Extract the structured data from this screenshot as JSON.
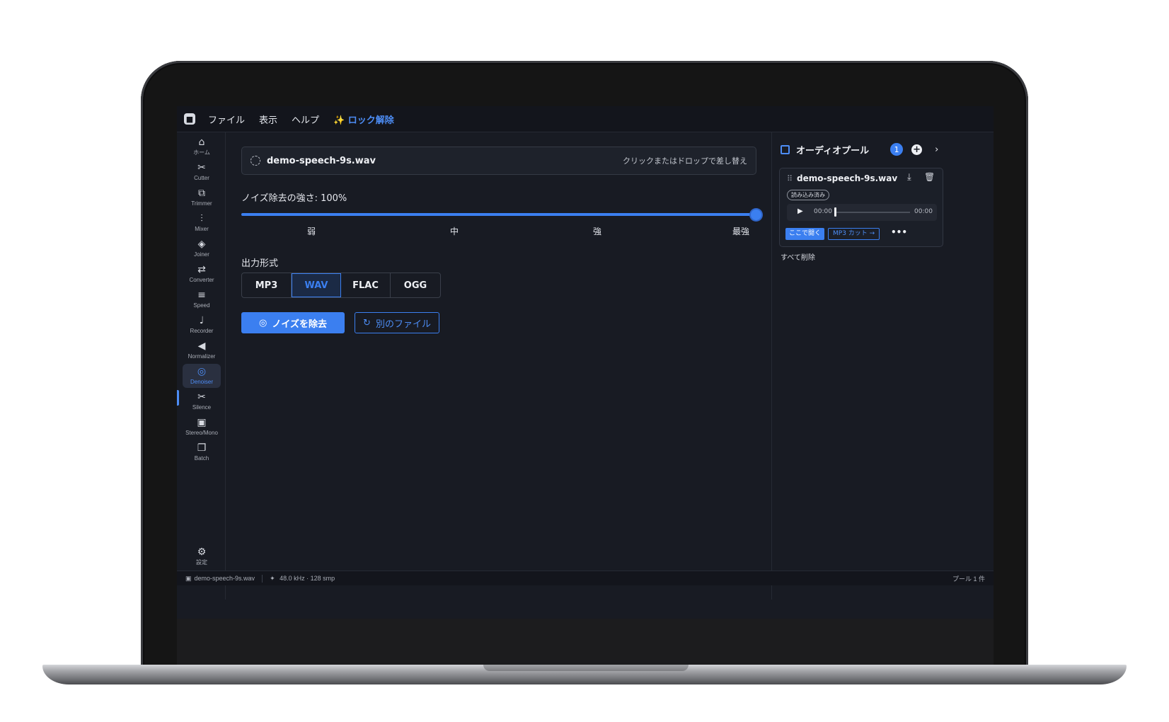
{
  "menubar": {
    "logo": "■",
    "items": [
      "ファイル",
      "表示",
      "ヘルプ"
    ],
    "unlock_label": "✨ ロック解除"
  },
  "sidebar": {
    "items": [
      {
        "icon": "home-icon",
        "glyph": "⌂",
        "label": "ホーム"
      },
      {
        "icon": "scissors-icon",
        "glyph": "✂",
        "label": "Cutter"
      },
      {
        "icon": "crop-icon",
        "glyph": "⧉",
        "label": "Trimmer"
      },
      {
        "icon": "mixer-icon",
        "glyph": "⫶",
        "label": "Mixer"
      },
      {
        "icon": "layers-icon",
        "glyph": "◈",
        "label": "Joiner"
      },
      {
        "icon": "swap-icon",
        "glyph": "⇄",
        "label": "Converter"
      },
      {
        "icon": "sliders-icon",
        "glyph": "≡",
        "label": "Speed"
      },
      {
        "icon": "microphone-icon",
        "glyph": "♩",
        "label": "Recorder"
      },
      {
        "icon": "volume-icon",
        "glyph": "◀",
        "label": "Normalizer"
      },
      {
        "icon": "denoise-icon",
        "glyph": "◎",
        "label": "Denoiser"
      },
      {
        "icon": "scissors-icon",
        "glyph": "✂",
        "label": "Silence"
      },
      {
        "icon": "speaker-icon",
        "glyph": "▣",
        "label": "Stereo/Mono"
      },
      {
        "icon": "batch-icon",
        "glyph": "❐",
        "label": "Batch"
      }
    ],
    "active_index": 9,
    "settings": {
      "icon": "gear-icon",
      "glyph": "⚙",
      "label": "設定"
    }
  },
  "main": {
    "file_name": "demo-speech-9s.wav",
    "file_hint": "クリックまたはドロップで差し替え",
    "strength_label": "ノイズ除去の強さ: 100%",
    "strength_value": 1.0,
    "ticks": [
      "弱",
      "中",
      "強",
      "最強"
    ],
    "format_label": "出力形式",
    "formats": [
      "MP3",
      "WAV",
      "FLAC",
      "OGG"
    ],
    "selected_format": "WAV",
    "denoise_button": "ノイズを除去",
    "other_file_button": "別のファイル"
  },
  "pool": {
    "title": "オーディオプール",
    "count": "1",
    "add": "+",
    "next": "›",
    "item": {
      "name": "demo-speech-9s.wav",
      "drag": "⠿",
      "download": "⤓",
      "delete": "🗑",
      "status": "読み込み済み",
      "play": "▶",
      "time_current": "00:00",
      "time_total": "00:00",
      "progress": 0.0,
      "open_here": "ここで開く",
      "mp3_cut": "MP3 カット →",
      "more": "•••"
    },
    "clear_all": "すべて削除"
  },
  "status": {
    "file": "demo-speech-9s.wav",
    "info": "48.0 kHz · 128 smp",
    "pool": "プール 1 件"
  },
  "colors": {
    "accent": "#3b7ff0",
    "background": "#181b23"
  }
}
